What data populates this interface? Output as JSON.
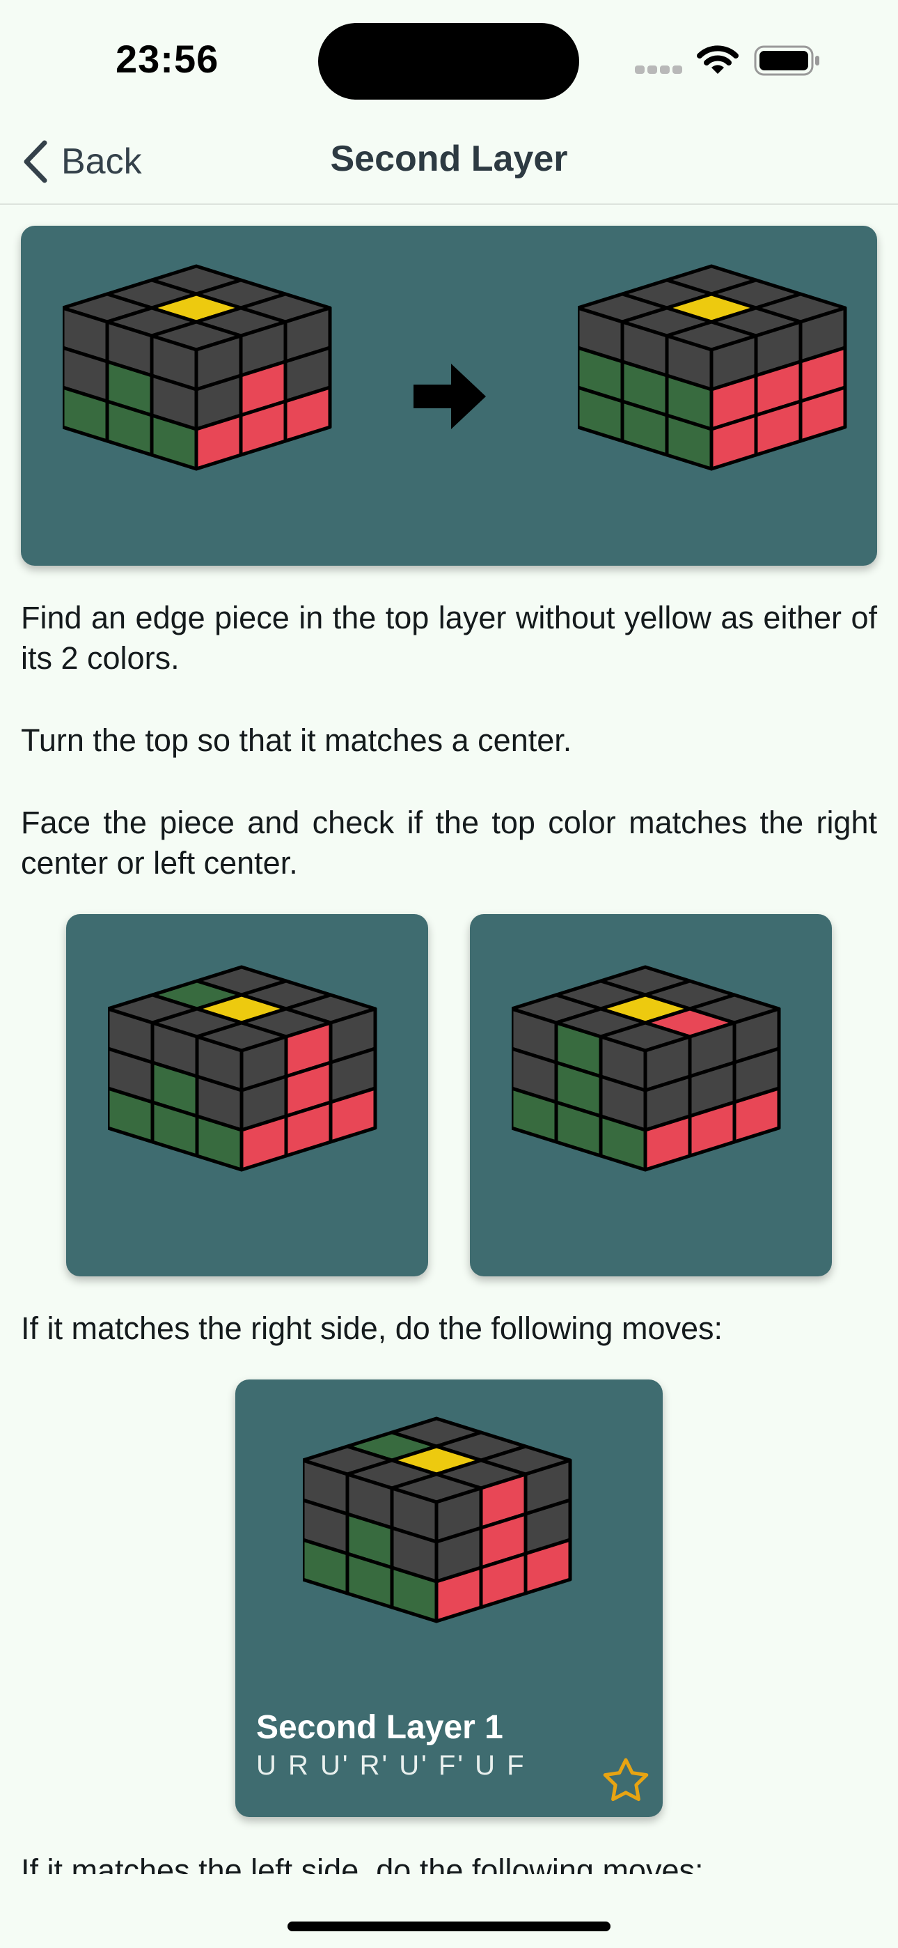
{
  "status_bar": {
    "time": "23:56"
  },
  "nav": {
    "back_label": "Back",
    "title": "Second Layer"
  },
  "content": {
    "intro_p1": "Find an edge piece in the top layer without yellow as either of its 2 colors.",
    "intro_p2": "Turn the top so that it matches a center.",
    "intro_p3": "Face the piece and check if the top color matches the right center or left center.",
    "right_side_text": "If it matches the right side, do the following moves:",
    "left_side_text": "If it matches the left side, do the following moves:"
  },
  "algorithm": {
    "name": "Second Layer 1",
    "moves": "U R U' R' U' F' U F"
  },
  "colors": {
    "card_bg": "#3f6c70",
    "cube_gray": "#444444",
    "yellow": "#edca0f",
    "red": "#e84756",
    "green": "#386b3f",
    "star": "#e8a412"
  }
}
